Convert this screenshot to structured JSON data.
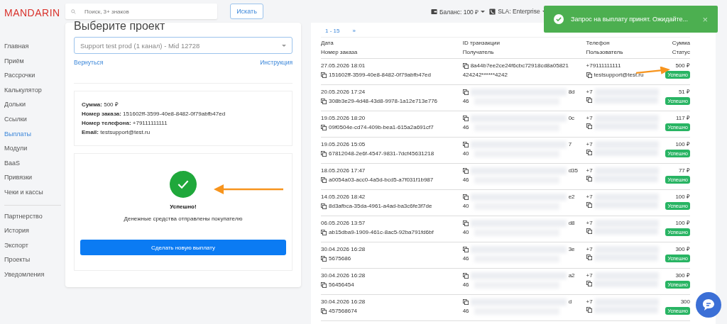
{
  "logo": "MANDARIN",
  "search": {
    "placeholder": "Поиск, 3+ знаков",
    "button": "Искать"
  },
  "topbar": {
    "balance": "Баланс: 100 ₽",
    "sla": "SLA: Enterprise"
  },
  "toast": {
    "text": "Запрос на выплату принят. Ожидайте...",
    "close": "×"
  },
  "sidebar": {
    "groups": [
      [
        {
          "label": "Главная",
          "selected": false
        },
        {
          "label": "Приём",
          "selected": false
        },
        {
          "label": "Рассрочки",
          "selected": false
        },
        {
          "label": "Калькулятор",
          "selected": false
        },
        {
          "label": "Дольки",
          "selected": false
        },
        {
          "label": "Ссылки",
          "selected": false
        },
        {
          "label": "Выплаты",
          "selected": true
        },
        {
          "label": "Модули",
          "selected": false
        },
        {
          "label": "BaaS",
          "selected": false
        },
        {
          "label": "Привязки",
          "selected": false
        },
        {
          "label": "Чеки и кассы",
          "selected": false
        }
      ],
      [
        {
          "label": "Партнерство",
          "selected": false
        },
        {
          "label": "История",
          "selected": false
        },
        {
          "label": "Экспорт",
          "selected": false
        },
        {
          "label": "Проекты",
          "selected": false
        },
        {
          "label": "Уведомления",
          "selected": false
        }
      ]
    ]
  },
  "project": {
    "title": "Выберите проект",
    "select_value": "Support test prod (1 канал) - Mid 12728",
    "back_link": "Вернуться",
    "help_link": "Инструкция"
  },
  "details": [
    {
      "label": "Сумма:",
      "value": "500 ₽"
    },
    {
      "label": "Номер заказа:",
      "value": "151602ff-3599-40e8-8482-0f79abfb47ed"
    },
    {
      "label": "Номер телефона:",
      "value": "+79111111111"
    },
    {
      "label": "Email:",
      "value": "testsupport@test.ru"
    }
  ],
  "result": {
    "title": "Успешно!",
    "message": "Денежные средства отправлены покупателю",
    "button": "Сделать новую выплату"
  },
  "pager": {
    "range": "1 - 15",
    "next": "»"
  },
  "table": {
    "columns": [
      [
        "Дата",
        "Номер заказа"
      ],
      [
        "ID транзакции",
        "Получатель"
      ],
      [
        "Телефон",
        "Пользователь"
      ],
      [
        "Сумма",
        "Статус"
      ]
    ],
    "rows": [
      {
        "date": "27.05.2026 18:01",
        "order": "151602ff-3599-40e8-8482-0f79abfb47ed",
        "redacted": false,
        "tx": "8a44b7ee2ce24f6cbc72918cd8a05821",
        "recipient": "424242******4242",
        "phone": "+79111111111",
        "user": "testsupport@test.ru",
        "sum": "500 ₽",
        "status": "Успешно"
      },
      {
        "date": "20.05.2026 17:24",
        "order": "308b3e29-4d48-43d8-9978-1a12e713e776",
        "redacted": true,
        "tx": "8d",
        "recipient": "46",
        "phone": "+7",
        "sum": "51 ₽",
        "status": "Успешно"
      },
      {
        "date": "19.05.2026 18:20",
        "order": "09f0504e-cd74-409b-bea1-615a2a691cf7",
        "redacted": true,
        "tx": "0c",
        "recipient": "46",
        "phone": "+7",
        "sum": "117 ₽",
        "status": "Успешно"
      },
      {
        "date": "19.05.2026 15:05",
        "order": "67812048-2e6f-4547-9831-7dcf45631218",
        "redacted": true,
        "tx": "7",
        "recipient": "40",
        "phone": "+7",
        "sum": "100 ₽",
        "status": "Успешно"
      },
      {
        "date": "18.05.2026 17:47",
        "order": "a0054a03-acc0-4a5d-bcd5-a7f031f1b987",
        "redacted": true,
        "tx": "d35",
        "recipient": "46",
        "phone": "+7",
        "sum": "77 ₽",
        "status": "Успешно"
      },
      {
        "date": "14.05.2026 18:42",
        "order": "8d3afbca-35da-4961-a4ad-ba3c6fe3f7de",
        "redacted": true,
        "tx": "e2",
        "recipient": "40",
        "phone": "+7",
        "sum": "100 ₽",
        "status": "Успешно"
      },
      {
        "date": "06.05.2026 13:57",
        "order": "ab15dba9-1909-461c-8ac5-92ba791fd6bf",
        "redacted": true,
        "tx": "d8",
        "recipient": "40",
        "phone": "+7",
        "sum": "100 ₽",
        "status": "Успешно"
      },
      {
        "date": "30.04.2026 16:28",
        "order": "5675686",
        "redacted": true,
        "tx": "3e",
        "recipient": "46",
        "phone": "+7",
        "sum": "300 ₽",
        "status": "Успешно"
      },
      {
        "date": "30.04.2026 16:28",
        "order": "56456454",
        "redacted": true,
        "tx": "a2",
        "recipient": "46",
        "phone": "+7",
        "sum": "300 ₽",
        "status": "Успешно"
      },
      {
        "date": "30.04.2026 16:28",
        "order": "457568674",
        "redacted": true,
        "tx": "d",
        "recipient": "46",
        "phone": "+7",
        "sum": "300",
        "status": "Успешно"
      }
    ]
  }
}
